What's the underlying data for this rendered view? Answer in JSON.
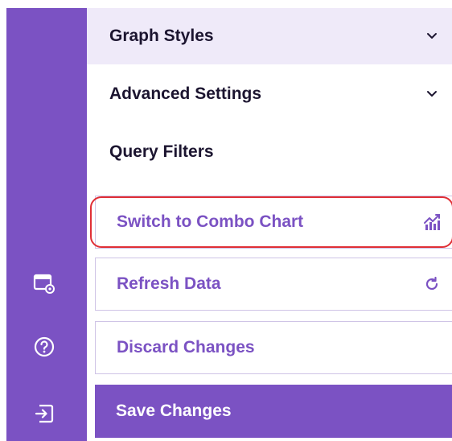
{
  "sidebar": {
    "icons": [
      {
        "name": "dashboard-settings-icon"
      },
      {
        "name": "help-icon"
      },
      {
        "name": "exit-icon"
      }
    ]
  },
  "panel": {
    "sections": [
      {
        "label": "Graph Styles",
        "expandable": true
      },
      {
        "label": "Advanced Settings",
        "expandable": true
      },
      {
        "label": "Query Filters",
        "expandable": false
      }
    ],
    "actions": [
      {
        "label": "Switch to Combo Chart",
        "icon": "combo-chart-icon",
        "highlighted": true
      },
      {
        "label": "Refresh Data",
        "icon": "refresh-icon",
        "highlighted": false
      },
      {
        "label": "Discard Changes",
        "icon": "",
        "highlighted": false
      }
    ],
    "save_label": "Save Changes"
  },
  "colors": {
    "accent": "#7b52c3",
    "section_hover_bg": "#efeaf9",
    "highlight_border": "#e02f36",
    "text_dark": "#1c1530"
  }
}
